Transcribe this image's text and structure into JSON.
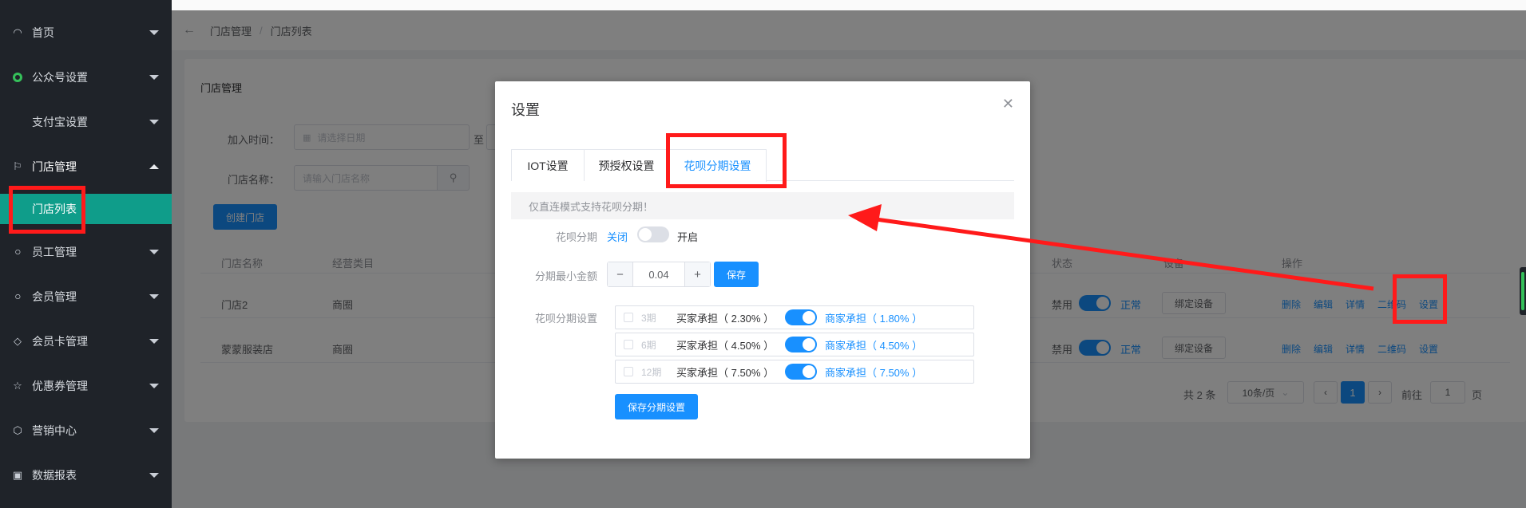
{
  "sidebar": {
    "items": [
      {
        "label": "首页",
        "icon": "dashboard-icon"
      },
      {
        "label": "公众号设置",
        "icon": "wechat-icon"
      },
      {
        "label": "支付宝设置",
        "icon": ""
      },
      {
        "label": "门店管理",
        "icon": "flag-icon"
      },
      {
        "label": "员工管理",
        "icon": "user-icon"
      },
      {
        "label": "会员管理",
        "icon": "user-icon"
      },
      {
        "label": "会员卡管理",
        "icon": "diamond-icon"
      },
      {
        "label": "优惠券管理",
        "icon": "star-icon"
      },
      {
        "label": "营销中心",
        "icon": "cube-icon"
      },
      {
        "label": "数据报表",
        "icon": "clipboard-icon"
      }
    ],
    "sub_item": "门店列表"
  },
  "breadcrumb": {
    "level1": "门店管理",
    "sep": "/",
    "level2": "门店列表"
  },
  "card": {
    "title": "门店管理",
    "join_time_label": "加入时间：",
    "date_placeholder": "请选择日期",
    "to_label": "至",
    "store_name_label": "门店名称：",
    "store_name_placeholder": "请输入门店名称",
    "create_button": "创建门店"
  },
  "table": {
    "headers": {
      "name": "门店名称",
      "category": "经营类目",
      "status": "状态",
      "device": "设备",
      "ops": "操作"
    },
    "rows": [
      {
        "name": "门店2",
        "category": "商圈",
        "disabled": "禁用",
        "normal": "正常",
        "bind": "绑定设备",
        "ops": [
          "删除",
          "编辑",
          "详情",
          "二维码",
          "设置"
        ]
      },
      {
        "name": "蒙蒙服装店",
        "category": "商圈",
        "disabled": "禁用",
        "normal": "正常",
        "bind": "绑定设备",
        "ops": [
          "删除",
          "编辑",
          "详情",
          "二维码",
          "设置"
        ]
      }
    ]
  },
  "pagination": {
    "total": "共 2 条",
    "page_size": "10条/页",
    "current": "1",
    "goto_label": "前往",
    "goto_value": "1",
    "page_unit": "页"
  },
  "modal": {
    "title": "设置",
    "tabs": [
      "IOT设置",
      "预授权设置",
      "花呗分期设置"
    ],
    "notice": "仅直连模式支持花呗分期！",
    "huabei_label": "花呗分期",
    "off_label": "关闭",
    "on_label": "开启",
    "min_amount_label": "分期最小金额",
    "min_amount_value": "0.04",
    "save_label": "保存",
    "installment_label": "花呗分期设置",
    "installments": [
      {
        "period": "3期",
        "buyer": "买家承担（ 2.30% ）",
        "merchant": "商家承担（ 1.80% ）"
      },
      {
        "period": "6期",
        "buyer": "买家承担（ 4.50% ）",
        "merchant": "商家承担（ 4.50% ）"
      },
      {
        "period": "12期",
        "buyer": "买家承担（ 7.50% ）",
        "merchant": "商家承担（ 7.50% ）"
      }
    ],
    "save_installment_label": "保存分期设置"
  },
  "colors": {
    "sidebar_bg": "#1f2329",
    "active_menu": "#0f9d8a",
    "primary": "#1890ff",
    "annotation": "#ff1a1a"
  }
}
